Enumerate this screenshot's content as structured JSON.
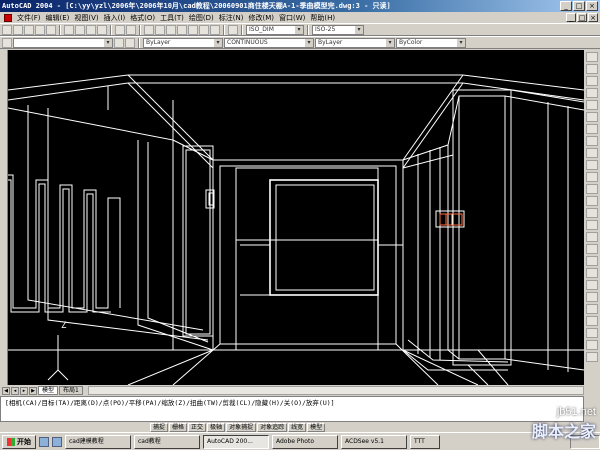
{
  "window": {
    "title": "AutoCAD 2004 - [C:\\yy\\yzl\\2006年\\2006年10月\\cad教程\\20060901商住楼天棚A-1-季曲模型完.dwg:3 - 只读]",
    "controls": [
      "_",
      "□",
      "×"
    ]
  },
  "menubar": {
    "items": [
      "文件(F)",
      "编辑(E)",
      "视图(V)",
      "插入(I)",
      "格式(O)",
      "工具(T)",
      "绘图(D)",
      "标注(N)",
      "修改(M)",
      "窗口(W)",
      "帮助(H)"
    ],
    "doc_controls": [
      "_",
      "□",
      "×"
    ]
  },
  "toolbar2": {
    "layer_combo": "ByLayer",
    "linetype_combo": "CONTINUOUS",
    "lineweight_combo": "ByLayer",
    "plotstyle_combo": "ByColor",
    "textstyle_combo": "ISO_DIM",
    "dimstyle_combo": "ISO-25"
  },
  "layout_tabs": [
    "模型",
    "布局1"
  ],
  "command_line": {
    "line1": "[相机(CA)/目标(TA)/距离(D)/点(PO)/平移(PA)/缩放(Z)/扭曲(TW)/剪裁(CL)/隐藏(H)/关(O)/放弃(U)]",
    "line2": ""
  },
  "status_buttons": [
    "捕捉",
    "栅格",
    "正交",
    "极轴",
    "对象捕捉",
    "对象追踪",
    "线宽",
    "模型"
  ],
  "taskbar": {
    "start": "开始",
    "tasks": [
      "cad建模教程",
      "cad教程",
      "AutoCAD 200...",
      "Adobe Photo",
      "ACDSee v5.1",
      "TTT"
    ],
    "active_task": 2,
    "tray_time": ""
  },
  "watermark": {
    "url": "jb51.net",
    "name": "脚本之家"
  },
  "ucs_label": "Z",
  "colors": {
    "canvas_bg": "#000000",
    "wire": "#ffffff",
    "accent": "#ff6a3c",
    "titlebar": "#0a246a"
  }
}
